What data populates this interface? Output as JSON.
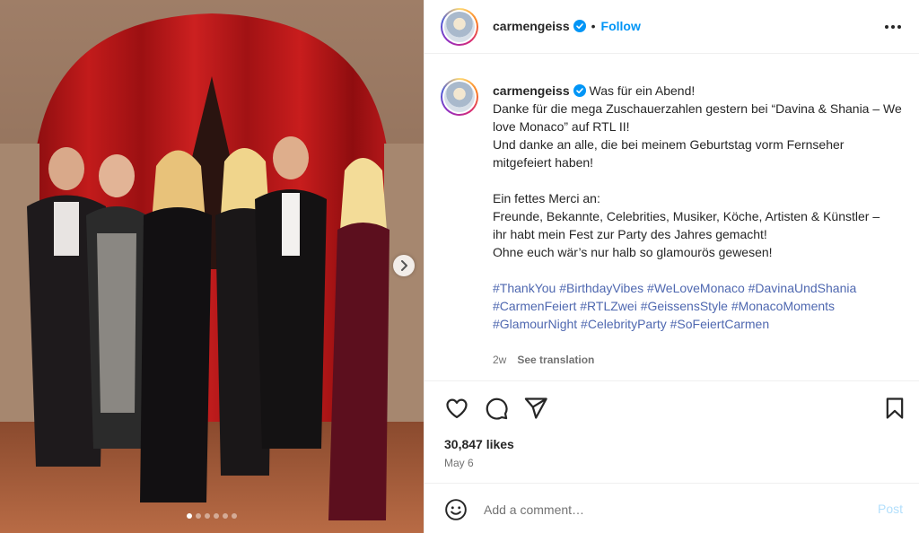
{
  "post": {
    "username": "carmengeiss",
    "follow_label": "Follow",
    "separator": "•",
    "more_icon": "more-horizontal-icon",
    "verified_color": "#0095f6",
    "caption_lines": [
      "Was für ein Abend!",
      "Danke für die mega Zuschauerzahlen gestern bei “Davina & Shania – We love Monaco” auf RTL II!",
      "Und danke an alle, die bei meinem Geburtstag vorm Fernseher mitgefeiert haben!",
      "",
      "Ein fettes Merci an:",
      "Freunde, Bekannte, Celebrities, Musiker, Köche, Artisten & Künstler –",
      "ihr habt mein Fest zur Party des Jahres gemacht!",
      "Ohne euch wär’s nur halb so glamourös gewesen!"
    ],
    "hashtags": [
      "#ThankYou",
      "#BirthdayVibes",
      "#WeLoveMonaco",
      "#DavinaUndShania",
      "#CarmenFeiert",
      "#RTLZwei",
      "#GeissensStyle",
      "#MonacoMoments",
      "#GlamourNight",
      "#CelebrityParty",
      "#SoFeiertCarmen"
    ],
    "age": "2w",
    "see_translation": "See translation",
    "likes": "30,847 likes",
    "date": "May 6"
  },
  "carousel": {
    "slide_count": 6,
    "active_index": 0,
    "next_icon": "chevron-right-icon"
  },
  "comment": {
    "placeholder": "Add a comment…",
    "post_label": "Post"
  },
  "colors": {
    "accent": "#0095f6",
    "text": "#262626",
    "muted": "#737373",
    "hashtag": "#4f68b0",
    "post_disabled": "#b2dffc"
  }
}
